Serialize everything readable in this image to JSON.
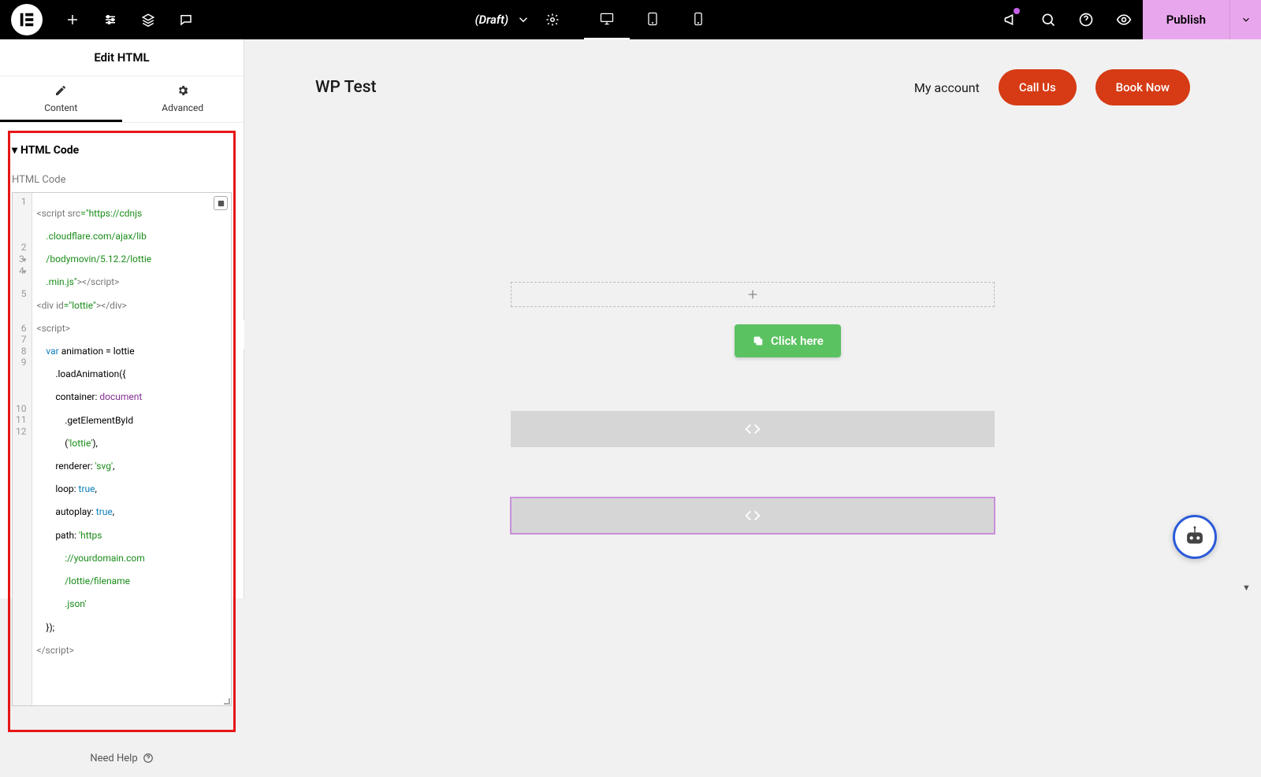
{
  "topbar": {
    "draft_label": "(Draft)",
    "publish_label": "Publish"
  },
  "sidebar": {
    "title": "Edit HTML",
    "tabs": {
      "content": "Content",
      "advanced": "Advanced"
    },
    "section_title": "HTML Code",
    "field_label": "HTML Code",
    "need_help": "Need Help"
  },
  "code": {
    "lines": [
      "1",
      "2",
      "3",
      "4",
      "5",
      "6",
      "7",
      "8",
      "9",
      "10",
      "11",
      "12"
    ],
    "l1a": "<script ",
    "l1b": "src",
    "l1c": "=\"https://cdnjs",
    "l1d": ".cloudflare.com/ajax/lib",
    "l1e": "/bodymovin/5.12.2/lottie",
    "l1f": ".min.js\"",
    "l1g": "></script>",
    "l2a": "<div ",
    "l2b": "id",
    "l2c": "=\"lottie\"",
    "l2d": "></div>",
    "l3": "<script>",
    "l4a": "    var",
    "l4b": " animation = lottie",
    "l4c": "        .loadAnimation({",
    "l5a": "        container: ",
    "l5b": "document",
    "l5c": "            .getElementById",
    "l5d": "            (",
    "l5e": "'lottie'",
    "l5f": "),",
    "l6a": "        renderer: ",
    "l6b": "'svg'",
    "l6c": ",",
    "l7a": "        loop: ",
    "l7b": "true",
    "l7c": ",",
    "l8a": "        autoplay: ",
    "l8b": "true",
    "l8c": ",",
    "l9a": "        path: ",
    "l9b": "'https",
    "l9c": "            ://yourdomain.com",
    "l9d": "            /lottie/filename",
    "l9e": "            .json'",
    "l10": "    });",
    "l11": "</script>"
  },
  "canvas": {
    "site_title": "WP Test",
    "nav_account": "My account",
    "btn_call": "Call Us",
    "btn_book": "Book Now",
    "click_here": "Click here"
  }
}
